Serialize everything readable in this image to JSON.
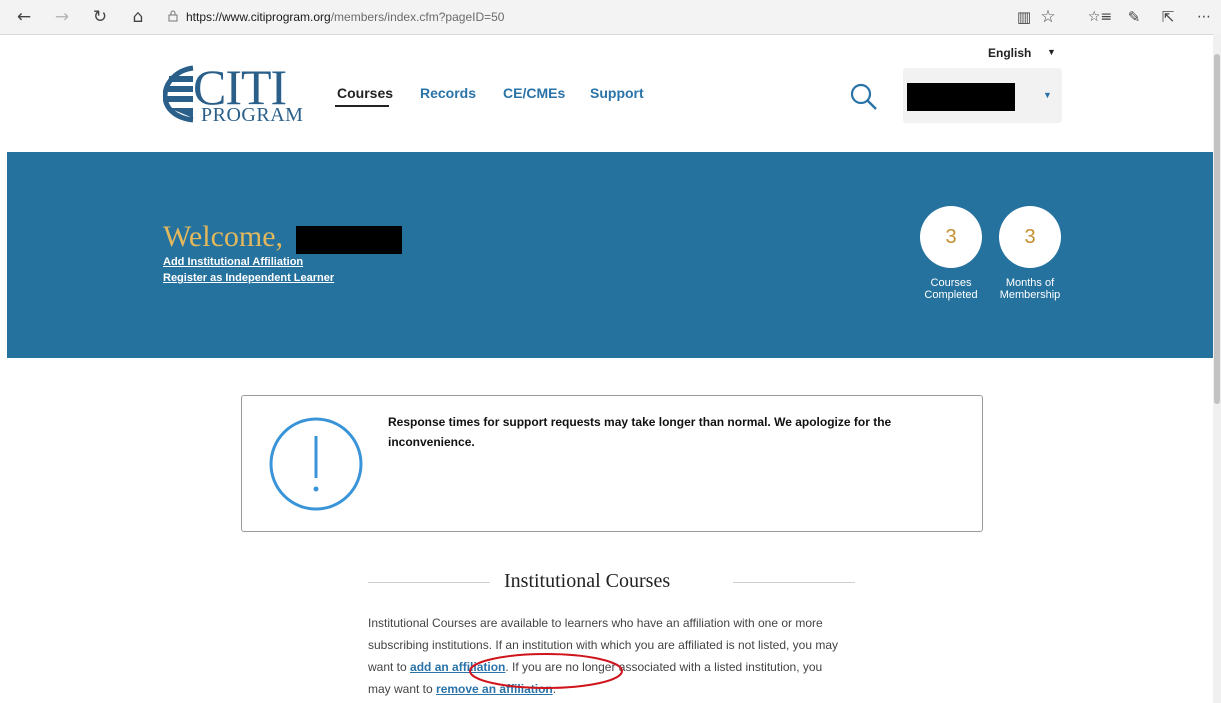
{
  "browser": {
    "url_host": "https://www.citiprogram.org",
    "url_path": "/members/index.cfm?pageID=50"
  },
  "header": {
    "language": "English",
    "logo_citi": "CITI",
    "logo_program": "PROGRAM",
    "nav": [
      "Courses",
      "Records",
      "CE/CMEs",
      "Support"
    ]
  },
  "hero": {
    "welcome": "Welcome,",
    "link_affiliation": "Add Institutional Affiliation",
    "link_independent": "Register as Independent Learner",
    "stats": [
      {
        "value": "3",
        "label_line1": "Courses",
        "label_line2": "Completed"
      },
      {
        "value": "3",
        "label_line1": "Months of",
        "label_line2": "Membership"
      }
    ]
  },
  "alert": {
    "text": "Response times for support requests may take longer than normal. We apologize for the inconvenience."
  },
  "institutional": {
    "title": "Institutional Courses",
    "text_1": "Institutional Courses are available to learners who have an affiliation with one or more subscribing institutions. If an institution with which you are affiliated is not listed, you may want to ",
    "link_add": "add an affiliation",
    "text_2": ". If you are no longer associated with a listed institution, you may want to ",
    "link_remove": "remove an affiliation",
    "text_3": "."
  },
  "colors": {
    "brand_blue": "#26729f",
    "gold": "#e2b85d",
    "link_blue": "#2a73a8",
    "annotation_red": "#d0141c"
  }
}
